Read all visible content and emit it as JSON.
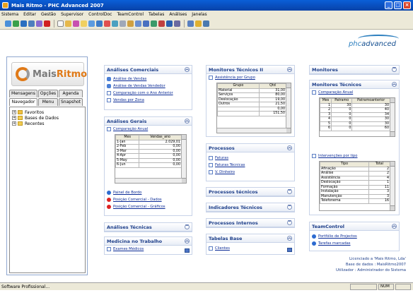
{
  "window": {
    "title": "Mais Ritmo - PHC Advanced 2007"
  },
  "menu": [
    "Sistema",
    "Editar",
    "Gestão",
    "Supervisor",
    "ControlDoc",
    "TeamControl",
    "Tabelas",
    "Análises",
    "Janelas"
  ],
  "brand": {
    "logo_text_a": "Mais",
    "logo_text_b": "Ritmo",
    "phc_a": "phc",
    "phc_b": "advanced"
  },
  "sidebar": {
    "tabs_row1": [
      "Mensagens",
      "Opções",
      "Agenda"
    ],
    "tabs_row2": [
      "Navegador",
      "Menu",
      "Snapshot"
    ],
    "tree": [
      "Favoritos",
      "Bases de Dados",
      "Recentes"
    ]
  },
  "panels": {
    "analises_comerciais": {
      "title": "Análises Comerciais",
      "links": [
        "Análise de Vendas",
        "Análise de Vendas Vendedor",
        "Comparação com o Ano Anterior",
        "Vendas por Zona"
      ]
    },
    "analises_gerais": {
      "title": "Análises Gerais",
      "link": "Comparação Anual",
      "cols": [
        "Mes",
        "Vendas_ano"
      ],
      "rows": [
        [
          "1-Jan",
          "2.029,01"
        ],
        [
          "2-Feb",
          "0,00"
        ],
        [
          "3-Mar",
          "0,00"
        ],
        [
          "4-Apr",
          "0,00"
        ],
        [
          "5-May",
          "0,00"
        ],
        [
          "6-Jun",
          "0,00"
        ]
      ],
      "links_after": [
        "Painel de Bordo",
        "Posição Comercial - Dados",
        "Posição Comercial - Gráficos"
      ]
    },
    "analises_tecnicas": {
      "title": "Análises Técnicas"
    },
    "medicina": {
      "title": "Medicina no Trabalho",
      "link": "Exames Médicos"
    },
    "monitores_tecnicos_ii": {
      "title": "Monitores Técnicos II",
      "link": "Assistência por Grupo",
      "cols": [
        "Grupo",
        "Qtd"
      ],
      "rows": [
        [
          "Material",
          "31,00"
        ],
        [
          "Serviços",
          "80,00"
        ],
        [
          "Deslocação",
          "19,00"
        ],
        [
          "Outros",
          "21,50"
        ],
        [
          "",
          "0,00"
        ],
        [
          "",
          "151,50"
        ]
      ]
    },
    "processos": {
      "title": "Processos",
      "links": [
        "Faturas",
        "Faturas Técnicas",
        "V. Dinheiro"
      ]
    },
    "processos_tecnicos": {
      "title": "Processos técnicos"
    },
    "indicadores_tecnicos": {
      "title": "Indicadores Técnicos"
    },
    "processos_internos": {
      "title": "Processos Internos"
    },
    "tabelas_base": {
      "title": "Tabelas Base",
      "link": "Clientes"
    },
    "monitores": {
      "title": "Monitores"
    },
    "monitores_tecnicos": {
      "title": "Monitores Técnicos",
      "link": "Comparação Anual",
      "cols": [
        "Mes",
        "Patramo",
        "Patramoanterior"
      ],
      "rows": [
        [
          "1",
          "30",
          "30"
        ],
        [
          "2",
          "0",
          "40"
        ],
        [
          "3",
          "0",
          "34"
        ],
        [
          "4",
          "0",
          "30"
        ],
        [
          "5",
          "0",
          "30"
        ],
        [
          "6",
          "0",
          "60"
        ]
      ],
      "link2": "Intervenções por tipo",
      "cols2": [
        "Tipo",
        "Total"
      ],
      "rows2": [
        [
          "Afinação",
          "2"
        ],
        [
          "Análise",
          "2"
        ],
        [
          "Assistência",
          "4"
        ],
        [
          "Deslocação",
          "1"
        ],
        [
          "Formação",
          "11"
        ],
        [
          "Instalação",
          "3"
        ],
        [
          "Manutenção",
          "3"
        ],
        [
          "Telefonema",
          "16"
        ]
      ]
    },
    "teamcontrol": {
      "title": "TeamControl",
      "links": [
        "Portfólio de Projectos",
        "Tarefas marcadas"
      ]
    }
  },
  "license": {
    "l1": "Licenciado a 'Mais Ritmo, Lda'",
    "l2": "Base de dados : MaisRitmo2007",
    "l3": "Utilizador : Administrador do Sistema"
  },
  "status": {
    "text": "Software Profissional...",
    "num": "NUM"
  }
}
